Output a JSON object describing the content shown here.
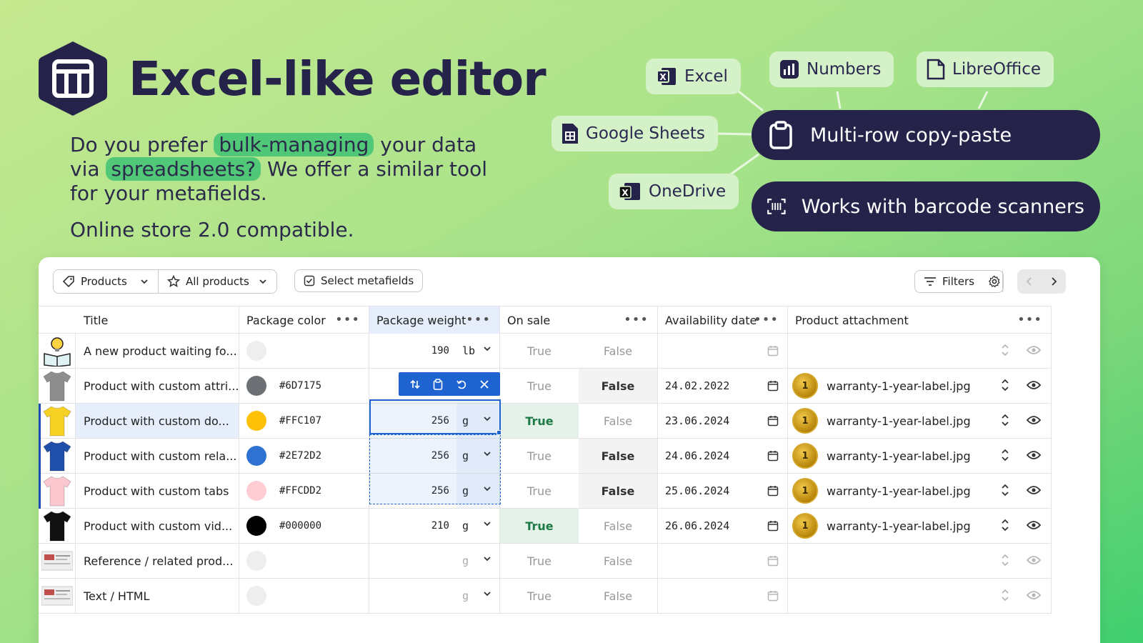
{
  "hero": {
    "title": "Excel-like editor",
    "line1_pre": "Do you prefer ",
    "line1_hl": "bulk-managing",
    "line1_post": " your data",
    "line2_pre": "via ",
    "line2_hl": "spreadsheets?",
    "line2_post": " We offer a similar tool",
    "line3": "for your metafields.",
    "sub": "Online store 2.0 compatible."
  },
  "integrations": {
    "excel": "Excel",
    "numbers": "Numbers",
    "libreoffice": "LibreOffice",
    "google_sheets": "Google Sheets",
    "onedrive": "OneDrive"
  },
  "features": {
    "copy_paste": "Multi-row copy-paste",
    "barcode": "Works with barcode scanners"
  },
  "toolbar": {
    "resource": "Products",
    "collection": "All products",
    "select_metafields": "Select metafields",
    "filters": "Filters"
  },
  "columns": {
    "title": "Title",
    "package_color": "Package color",
    "package_weight": "Package weight",
    "on_sale": "On sale",
    "availability_date": "Availability date",
    "product_attachment": "Product attachment"
  },
  "labels": {
    "true": "True",
    "false": "False"
  },
  "rows": [
    {
      "title": "A new product waiting fo...",
      "color_hex": "",
      "swatch": "#eeeeee",
      "weight": "190",
      "unit": "lb",
      "sale": "none",
      "date": "",
      "attachment": "",
      "faded": false,
      "thumb": "bulb"
    },
    {
      "title": "Product with custom attri...",
      "color_hex": "#6D7175",
      "swatch": "#6D7175",
      "weight": "",
      "unit": "",
      "sale": "false",
      "date": "24.02.2022",
      "attachment": "warranty-1-year-label.jpg",
      "faded": false,
      "thumb": "#8e8e8e"
    },
    {
      "title": "Product with custom do...",
      "color_hex": "#FFC107",
      "swatch": "#FFC107",
      "weight": "256",
      "unit": "g",
      "sale": "true",
      "date": "23.06.2024",
      "attachment": "warranty-1-year-label.jpg",
      "faded": false,
      "thumb": "#f5d224"
    },
    {
      "title": "Product with custom rela...",
      "color_hex": "#2E72D2",
      "swatch": "#2E72D2",
      "weight": "256",
      "unit": "g",
      "sale": "false",
      "date": "24.06.2024",
      "attachment": "warranty-1-year-label.jpg",
      "faded": false,
      "thumb": "#1f4fa8"
    },
    {
      "title": "Product with custom tabs",
      "color_hex": "#FFCDD2",
      "swatch": "#FFCDD2",
      "weight": "256",
      "unit": "g",
      "sale": "false",
      "date": "25.06.2024",
      "attachment": "warranty-1-year-label.jpg",
      "faded": false,
      "thumb": "#fbc8d0"
    },
    {
      "title": "Product with custom vid...",
      "color_hex": "#000000",
      "swatch": "#000000",
      "weight": "210",
      "unit": "g",
      "sale": "true",
      "date": "26.06.2024",
      "attachment": "warranty-1-year-label.jpg",
      "faded": false,
      "thumb": "#111111"
    },
    {
      "title": "Reference / related prod...",
      "color_hex": "",
      "swatch": "#eeeeee",
      "weight": "",
      "unit": "g",
      "sale": "none",
      "date": "",
      "attachment": "",
      "faded": true,
      "thumb": "doc"
    },
    {
      "title": "Text / HTML",
      "color_hex": "",
      "swatch": "#eeeeee",
      "weight": "",
      "unit": "g",
      "sale": "none",
      "date": "",
      "attachment": "",
      "faded": true,
      "thumb": "doc2"
    }
  ],
  "medal_text": "1"
}
